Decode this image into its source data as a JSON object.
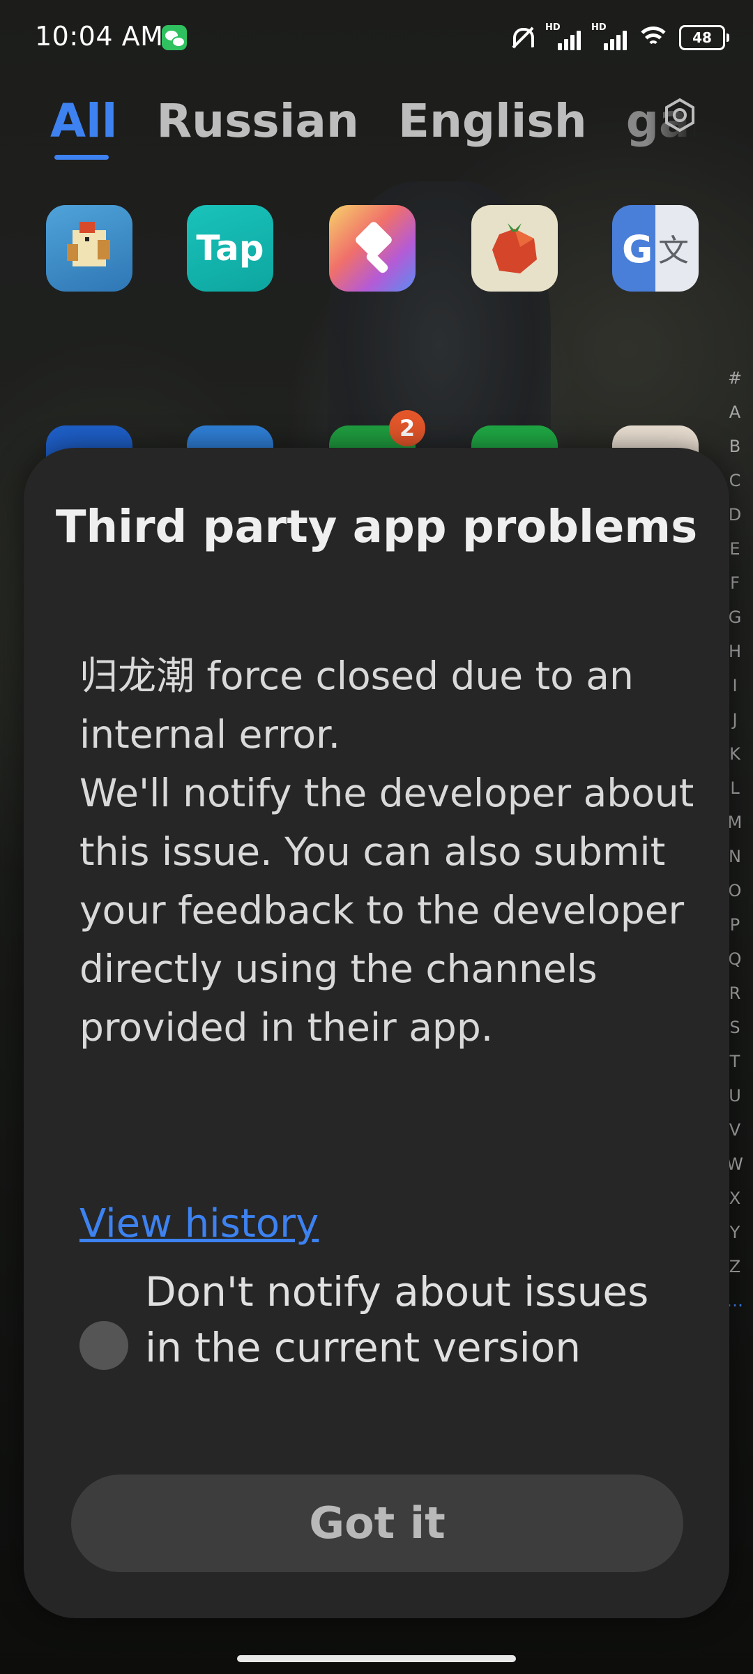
{
  "status_bar": {
    "time": "10:04 AM",
    "battery": "48",
    "network_label": "HD",
    "icons": [
      "wechat-icon",
      "mute-bell-icon",
      "signal-icon",
      "signal-icon",
      "wifi-icon",
      "battery-icon"
    ]
  },
  "tabs": [
    {
      "label": "All",
      "active": true
    },
    {
      "label": "Russian"
    },
    {
      "label": "English"
    },
    {
      "label": "gar"
    }
  ],
  "settings_icon": "gear-icon",
  "apps": {
    "tap_label": "Tap",
    "badge_count": "2"
  },
  "alphabet_index": [
    "#",
    "A",
    "B",
    "C",
    "D",
    "E",
    "F",
    "G",
    "H",
    "I",
    "J",
    "K",
    "L",
    "M",
    "N",
    "O",
    "P",
    "Q",
    "R",
    "S",
    "T",
    "U",
    "V",
    "W",
    "X",
    "Y",
    "Z",
    "…"
  ],
  "dialog": {
    "title": "Third party app problems",
    "message": "归龙潮 force closed due to an internal error.\nWe'll notify the developer about this issue. You can also submit your feedback to the developer directly using the channels provided in their app.",
    "link": "View history",
    "checkbox_label": "Don't notify about issues in the current version",
    "checkbox_checked": false,
    "button": "Got it"
  },
  "colors": {
    "accent": "#3d82f0",
    "dialog_bg": "#262626",
    "button_bg": "#3d3d3d",
    "badge": "#e2562a"
  }
}
